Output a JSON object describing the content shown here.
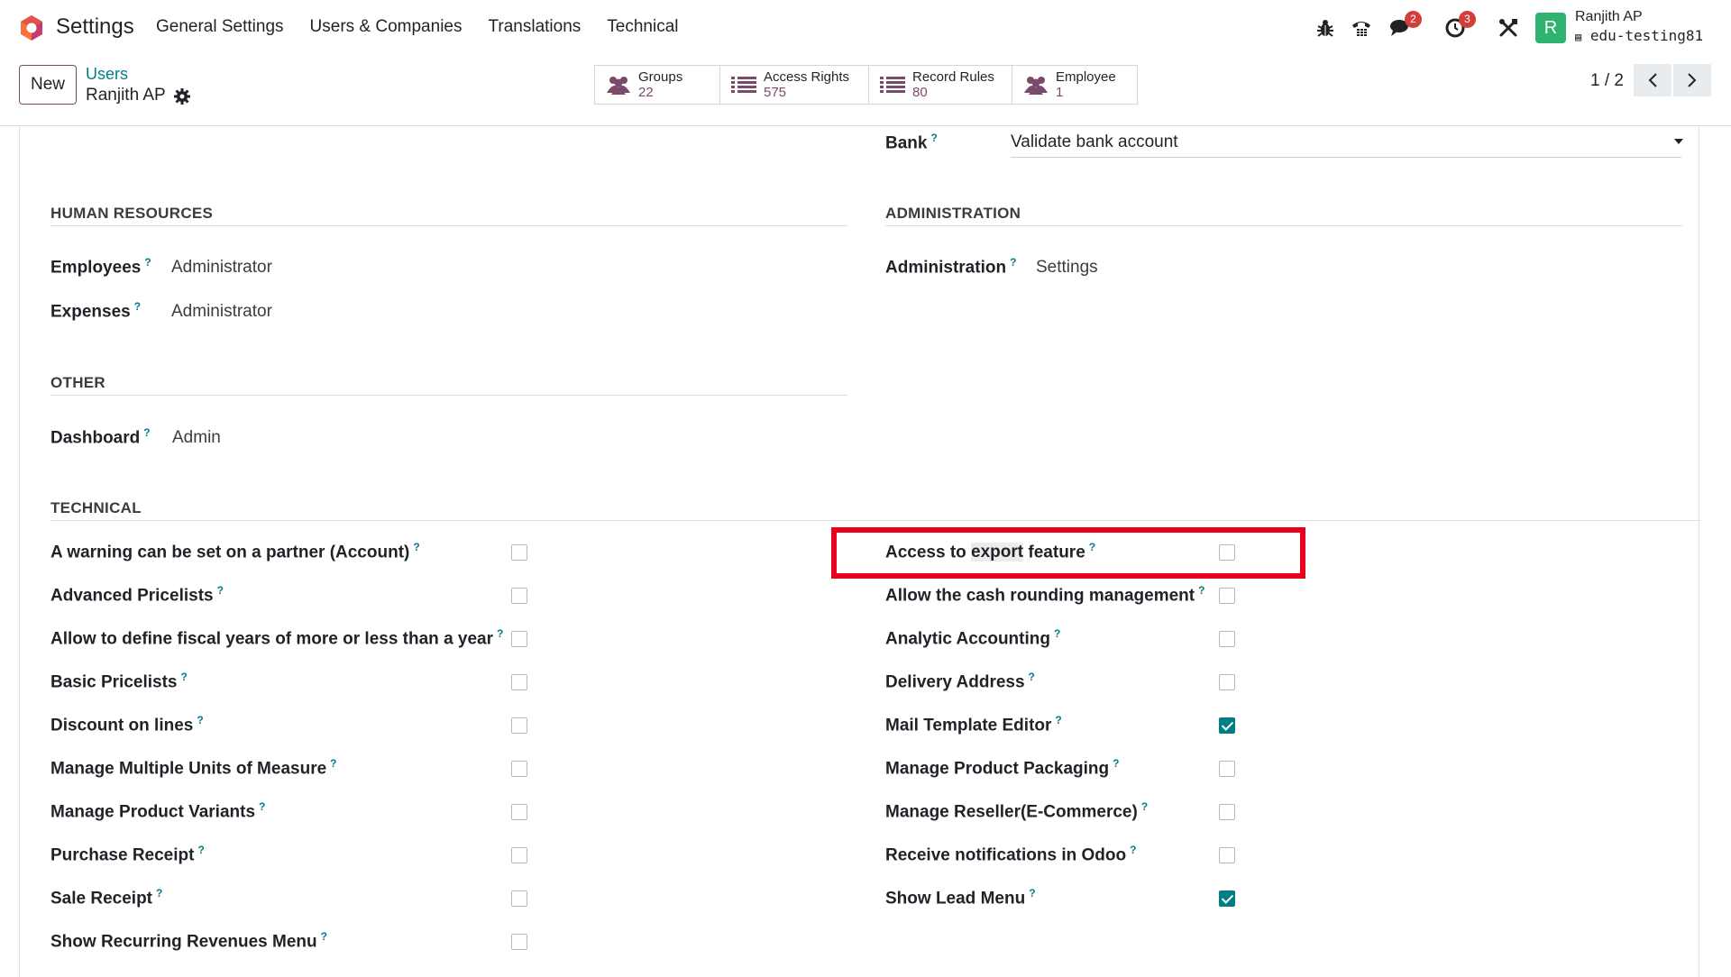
{
  "navbar": {
    "app_name": "Settings",
    "menu": [
      "General Settings",
      "Users & Companies",
      "Translations",
      "Technical"
    ],
    "icons": [
      "bug-icon",
      "phone-icon",
      "chat-icon",
      "activity-clock-icon",
      "tools-icon"
    ],
    "chat_badge": "2",
    "activity_badge": "3",
    "avatar_letter": "R",
    "user_name": "Ranjith AP",
    "db_name": "edu-testing81"
  },
  "control": {
    "new_label": "New",
    "breadcrumb_parent": "Users",
    "breadcrumb_current": "Ranjith AP",
    "smart_buttons": [
      {
        "label": "Groups",
        "value": "22",
        "icon": "users-icon"
      },
      {
        "label": "Access Rights",
        "value": "575",
        "icon": "list-icon"
      },
      {
        "label": "Record Rules",
        "value": "80",
        "icon": "list-icon"
      },
      {
        "label": "Employee",
        "value": "1",
        "icon": "users-icon"
      }
    ],
    "pager": "1 / 2"
  },
  "form": {
    "bank": {
      "label": "Bank",
      "value": "Validate bank account"
    },
    "human_resources": {
      "title": "HUMAN RESOURCES",
      "fields": [
        {
          "label": "Employees",
          "value": "Administrator"
        },
        {
          "label": "Expenses",
          "value": "Administrator"
        }
      ]
    },
    "administration": {
      "title": "ADMINISTRATION",
      "fields": [
        {
          "label": "Administration",
          "value": "Settings"
        }
      ]
    },
    "other": {
      "title": "OTHER",
      "fields": [
        {
          "label": "Dashboard",
          "value": "Admin"
        }
      ]
    },
    "technical": {
      "title": "TECHNICAL",
      "left": [
        {
          "label": "A warning can be set on a partner (Account)",
          "checked": false
        },
        {
          "label": "Advanced Pricelists",
          "checked": false
        },
        {
          "label": "Allow to define fiscal years of more or less than a year",
          "checked": false
        },
        {
          "label": "Basic Pricelists",
          "checked": false
        },
        {
          "label": "Discount on lines",
          "checked": false
        },
        {
          "label": "Manage Multiple Units of Measure",
          "checked": false
        },
        {
          "label": "Manage Product Variants",
          "checked": false
        },
        {
          "label": "Purchase Receipt",
          "checked": false
        },
        {
          "label": "Sale Receipt",
          "checked": false
        },
        {
          "label": "Show Recurring Revenues Menu",
          "checked": false
        }
      ],
      "right": [
        {
          "label_pre": "Access to ",
          "label_hl": "export",
          "label_post": " feature",
          "checked": false
        },
        {
          "label": "Allow the cash rounding management",
          "checked": false
        },
        {
          "label": "Analytic Accounting",
          "checked": false
        },
        {
          "label": "Delivery Address",
          "checked": false
        },
        {
          "label": "Mail Template Editor",
          "checked": true
        },
        {
          "label": "Manage Product Packaging",
          "checked": false
        },
        {
          "label": "Manage Reseller(E-Commerce)",
          "checked": false
        },
        {
          "label": "Receive notifications in Odoo",
          "checked": false
        },
        {
          "label": "Show Lead Menu",
          "checked": true
        }
      ]
    },
    "help_mark": "?"
  },
  "colors": {
    "accent_teal": "#017e84",
    "brand_purple": "#7b4a6b",
    "highlight_red": "#e8001c",
    "badge_red": "#d23f3a"
  }
}
